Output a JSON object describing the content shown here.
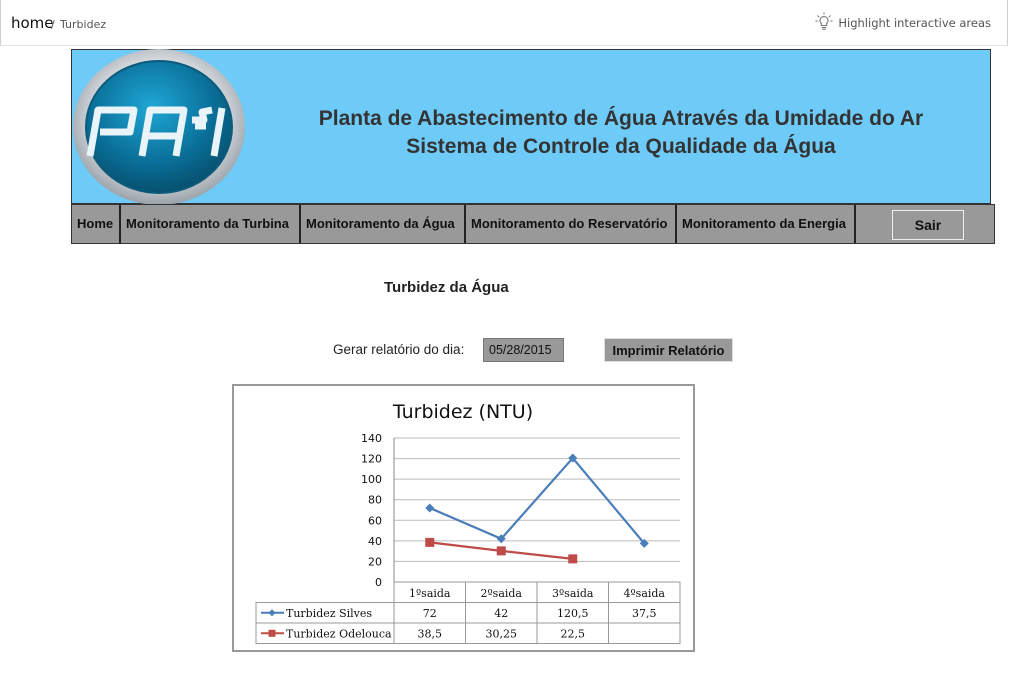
{
  "breadcrumb": {
    "home": "home",
    "separator": "/",
    "current": "Turbidez"
  },
  "highlight_toggle": {
    "label": "Highlight interactive areas",
    "icon": "lightbulb-icon"
  },
  "banner": {
    "logo_text": "PA³1",
    "title_line1": "Planta de Abastecimento de Água Através da Umidade do Ar",
    "title_line2": "Sistema de Controle da Qualidade da Água",
    "background_color": "#6ecbf8"
  },
  "nav": {
    "items": [
      {
        "label": "Home"
      },
      {
        "label": "Monitoramento da Turbina"
      },
      {
        "label": "Monitoramento da Água"
      },
      {
        "label": "Monitoramento do Reservatório"
      },
      {
        "label": "Monitoramento da Energia"
      }
    ],
    "logout_label": "Sair"
  },
  "page": {
    "title": "Turbidez da Água",
    "report_label": "Gerar relatório do dia:",
    "report_date": "05/28/2015",
    "print_button": "Imprimir Relatório"
  },
  "chart_data": {
    "type": "line",
    "title": "Turbidez (NTU)",
    "categories": [
      "1ºsaida",
      "2ºsaida",
      "3ºsaida",
      "4ºsaida"
    ],
    "ylim": [
      0,
      140
    ],
    "yticks": [
      0,
      20,
      40,
      60,
      80,
      100,
      120,
      140
    ],
    "grid": true,
    "legend": "data-table",
    "series": [
      {
        "name": "Turbidez Silves",
        "values": [
          72,
          42,
          120.5,
          37.5
        ],
        "labels": [
          "72",
          "42",
          "120,5",
          "37,5"
        ],
        "color": "#4a7ebb",
        "marker": "diamond"
      },
      {
        "name": "Turbidez Odelouca",
        "values": [
          38.5,
          30.25,
          22.5,
          null
        ],
        "labels": [
          "38,5",
          "30,25",
          "22,5",
          ""
        ],
        "color": "#be4b48",
        "marker": "square"
      }
    ]
  }
}
